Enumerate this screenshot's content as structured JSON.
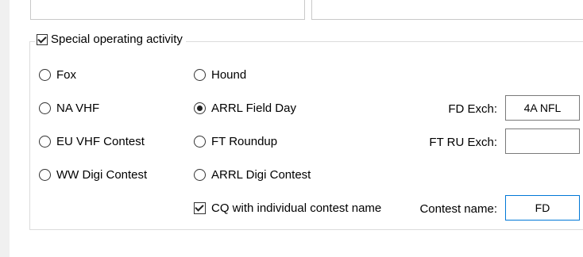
{
  "group": {
    "title": "Special operating activity",
    "checked": true
  },
  "options": {
    "fox": "Fox",
    "na_vhf": "NA VHF",
    "eu_vhf": "EU VHF Contest",
    "ww_digi": "WW Digi Contest",
    "hound": "Hound",
    "arrl_fd": "ARRL Field Day",
    "ft_roundup": "FT Roundup",
    "arrl_digi": "ARRL Digi Contest",
    "selected": "ARRL Field Day"
  },
  "cq_individual": {
    "label": "CQ with individual contest name",
    "checked": true
  },
  "fields": {
    "fd_exch": {
      "label": "FD Exch:",
      "value": "4A NFL"
    },
    "ft_ru_exch": {
      "label": "FT RU Exch:",
      "value": ""
    },
    "contest_name": {
      "label": "Contest name:",
      "value": "FD"
    }
  }
}
